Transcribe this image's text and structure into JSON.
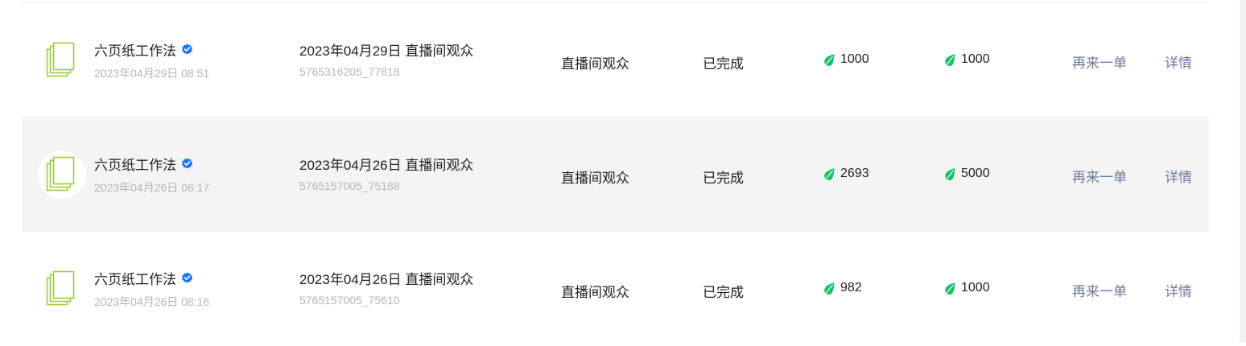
{
  "colors": {
    "accent_green": "#19be6b",
    "verified_blue": "#1677ff",
    "link": "#6a7a97",
    "avatar_stroke": "#9ccc3c"
  },
  "icons": {
    "avatar": "stacked-pages-icon",
    "verified": "verified-badge-icon",
    "currency": "green-leaf-icon"
  },
  "orders": [
    {
      "account_name": "六页纸工作法",
      "account_time": "2023年04月29日 08:51",
      "title": "2023年04月29日 直播间观众",
      "order_no": "5765316205_77818",
      "type": "直播间观众",
      "status": "已完成",
      "amount_1": "1000",
      "amount_2": "1000",
      "reorder_label": "再来一单",
      "detail_label": "详情"
    },
    {
      "account_name": "六页纸工作法",
      "account_time": "2023年04月26日 08:17",
      "title": "2023年04月26日 直播间观众",
      "order_no": "5765157005_75188",
      "type": "直播间观众",
      "status": "已完成",
      "amount_1": "2693",
      "amount_2": "5000",
      "reorder_label": "再来一单",
      "detail_label": "详情"
    },
    {
      "account_name": "六页纸工作法",
      "account_time": "2023年04月26日 08:16",
      "title": "2023年04月26日 直播间观众",
      "order_no": "5765157005_75610",
      "type": "直播间观众",
      "status": "已完成",
      "amount_1": "982",
      "amount_2": "1000",
      "reorder_label": "再来一单",
      "detail_label": "详情"
    }
  ]
}
